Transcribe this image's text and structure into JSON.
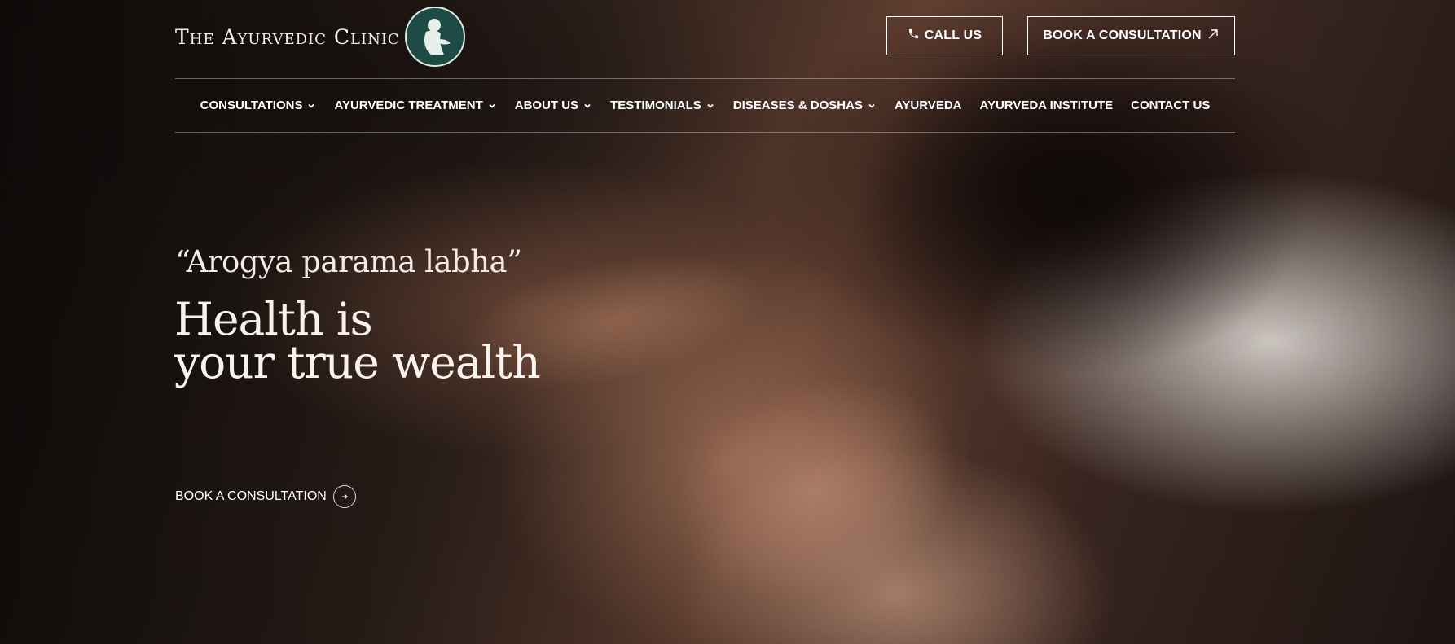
{
  "header": {
    "logo_text": "The Ayurvedic Clinic",
    "call_label": "CALL US",
    "book_label": "BOOK A CONSULTATION"
  },
  "nav": {
    "items": [
      {
        "label": "CONSULTATIONS",
        "dropdown": true
      },
      {
        "label": "AYURVEDIC TREATMENT",
        "dropdown": true
      },
      {
        "label": "ABOUT US",
        "dropdown": true
      },
      {
        "label": "TESTIMONIALS",
        "dropdown": true
      },
      {
        "label": "DISEASES & DOSHAS",
        "dropdown": true
      },
      {
        "label": "AYURVEDA",
        "dropdown": false
      },
      {
        "label": "AYURVEDA INSTITUTE",
        "dropdown": false
      },
      {
        "label": "CONTACT US",
        "dropdown": false
      }
    ]
  },
  "hero": {
    "quote": "“Arogya parama labha”",
    "headline_line1": "Health is",
    "headline_line2": "your true wealth",
    "cta_label": "BOOK A CONSULTATION"
  },
  "colors": {
    "logo_badge": "#1e4b45",
    "text": "#ffffff"
  },
  "icons": {
    "call": "phone-icon",
    "book": "arrow-up-right-icon",
    "nav_dropdown": "chevron-down-icon",
    "cta": "arrow-right-icon"
  }
}
